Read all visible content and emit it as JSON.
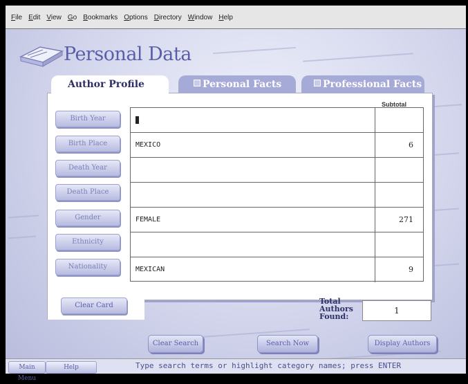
{
  "menu": [
    "File",
    "Edit",
    "View",
    "Go",
    "Bookmarks",
    "Options",
    "Directory",
    "Window",
    "Help"
  ],
  "header": {
    "title": "Personal Data"
  },
  "tabs": [
    {
      "label": "Author Profile",
      "active": true
    },
    {
      "label": "Personal Facts",
      "active": false
    },
    {
      "label": "Professional Facts",
      "active": false
    }
  ],
  "grid": {
    "subtotal_header": "Subtotal",
    "rows": [
      {
        "category": "Birth Year",
        "value": "",
        "subtotal": ""
      },
      {
        "category": "Birth Place",
        "value": "MEXICO",
        "subtotal": "6"
      },
      {
        "category": "Death Year",
        "value": "",
        "subtotal": ""
      },
      {
        "category": "Death Place",
        "value": "",
        "subtotal": ""
      },
      {
        "category": "Gender",
        "value": "FEMALE",
        "subtotal": "271"
      },
      {
        "category": "Ethnicity",
        "value": "",
        "subtotal": ""
      },
      {
        "category": "Nationality",
        "value": "MEXICAN",
        "subtotal": "9"
      }
    ]
  },
  "clear_card_label": "Clear Card",
  "totals": {
    "label_line1": "Total",
    "label_line2": "Authors",
    "label_line3": "Found:",
    "value": "1"
  },
  "actions": {
    "clear_search": "Clear Search",
    "search_now": "Search Now",
    "display_authors": "Display Authors"
  },
  "statusbar": {
    "main_menu": "Main Menu",
    "help": "Help",
    "text": "Type search terms or highlight category names; press ENTER"
  },
  "colors": {
    "accent": "#5a5ea8",
    "background": "#c9cbe6",
    "tab_inactive": "#a6aad6"
  }
}
